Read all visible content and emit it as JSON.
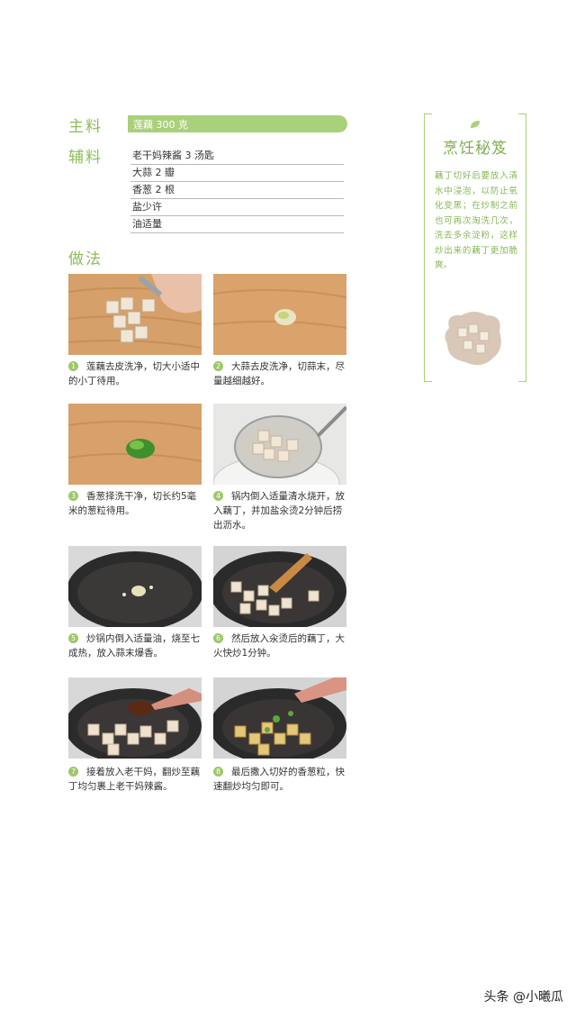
{
  "main_ingredient": {
    "label": "主料",
    "value": "莲藕 300 克"
  },
  "aux_ingredients": {
    "label": "辅料",
    "items": [
      "老干妈辣酱 3 汤匙",
      "大蒜 2 瓣",
      "香葱 2 根",
      "盐少许",
      "油适量"
    ]
  },
  "method": {
    "label": "做法",
    "steps": [
      {
        "num": "1",
        "text": "莲藕去皮洗净，切大小适中的小丁待用。"
      },
      {
        "num": "2",
        "text": "大蒜去皮洗净，切蒜末，尽量越细越好。"
      },
      {
        "num": "3",
        "text": "香葱择洗干净，切长约5毫米的葱粒待用。"
      },
      {
        "num": "4",
        "text": "锅内倒入适量清水烧开，放入藕丁，并加盐汆烫2分钟后捞出沥水。"
      },
      {
        "num": "5",
        "text": "炒锅内倒入适量油，烧至七成热，放入蒜末爆香。"
      },
      {
        "num": "6",
        "text": "然后放入汆烫后的藕丁，大火快炒1分钟。"
      },
      {
        "num": "7",
        "text": "接着放入老干妈，翻炒至藕丁均匀裹上老干妈辣酱。"
      },
      {
        "num": "8",
        "text": "最后撒入切好的香葱粒，快速翻炒均匀即可。"
      }
    ]
  },
  "tips": {
    "title": "烹饪秘笈",
    "text": "藕丁切好后要放入清水中浸泡，以防止氧化变黑；在炒制之前也可再次淘洗几次，洗去多余淀粉，这样炒出来的藕丁更加脆爽。"
  },
  "footer": {
    "watermark": "头条 @小曦瓜"
  },
  "colors": {
    "accent": "#a9d07a",
    "title_green": "#8cbd5a"
  }
}
